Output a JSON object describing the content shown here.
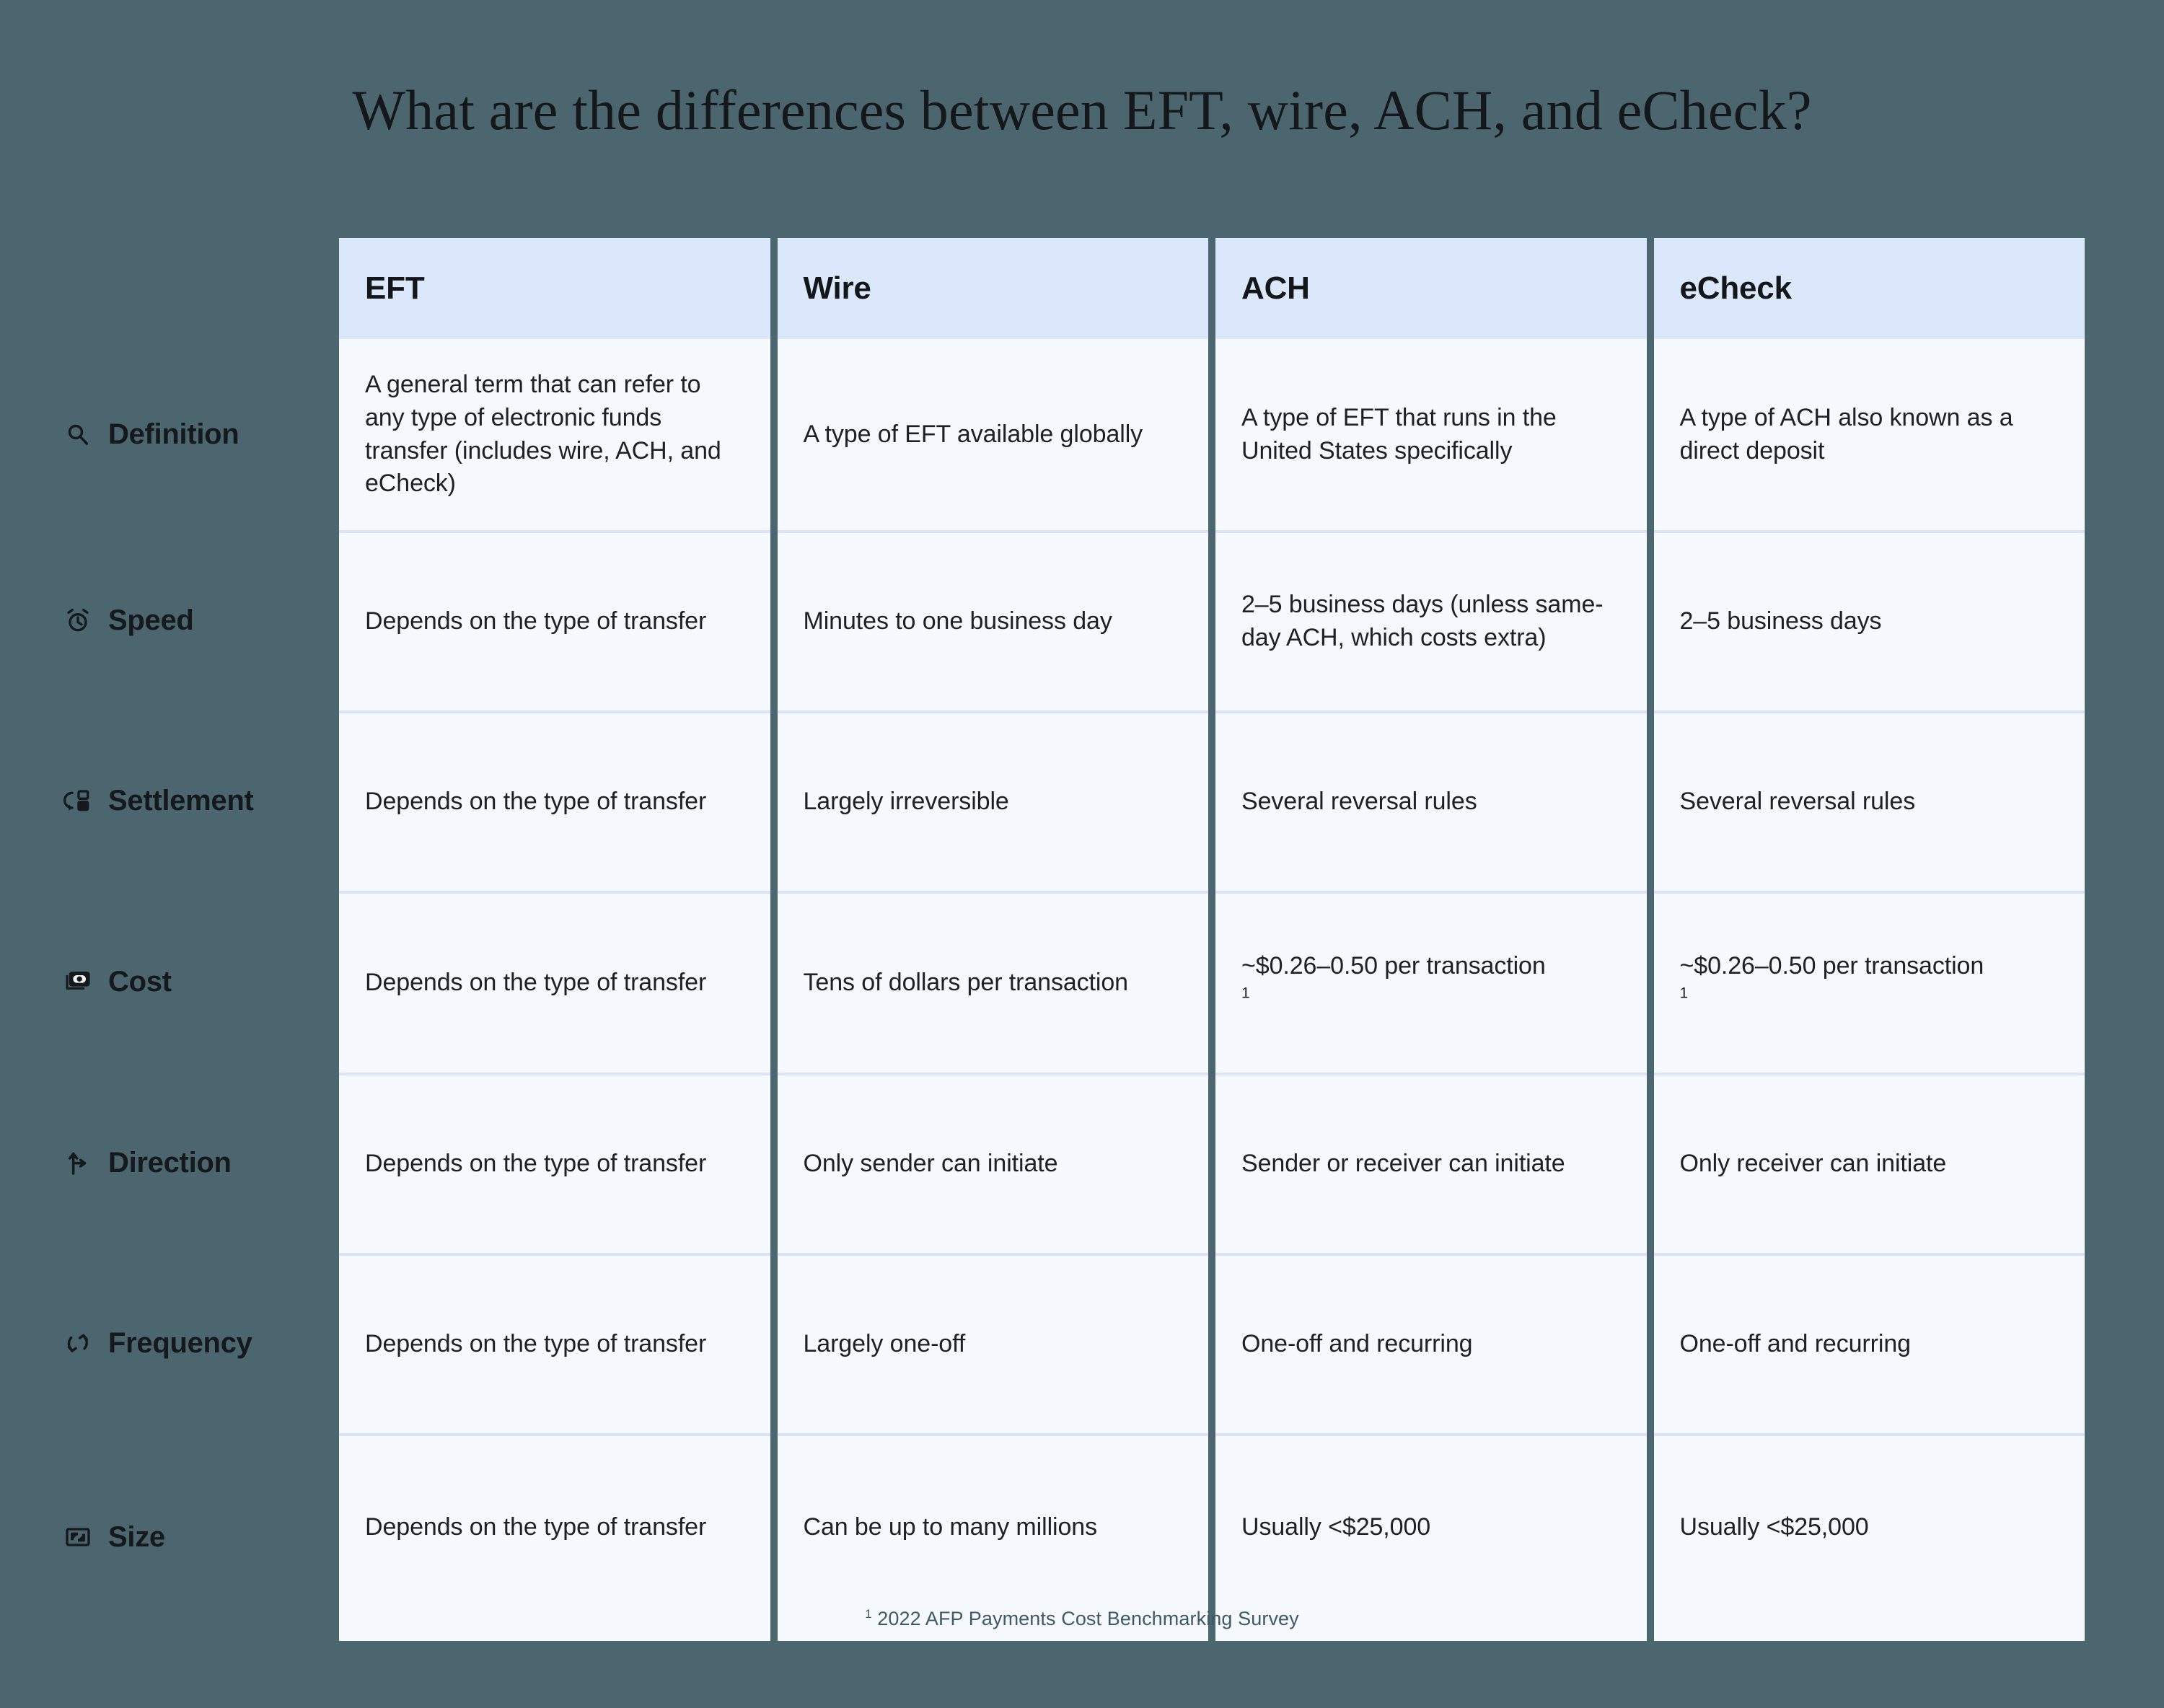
{
  "title": "What are the differences between EFT, wire, ACH, and eCheck?",
  "colors": {
    "page_background": "#4b666f",
    "header_cell_background": "#dbe8fb",
    "body_cell_background": "#f5f8fd",
    "row_divider": "#d7e4fa",
    "text": "#1d2124",
    "footnote_text": "#3f5a64"
  },
  "table": {
    "columns": [
      {
        "key": "eft",
        "label": "EFT"
      },
      {
        "key": "wire",
        "label": "Wire"
      },
      {
        "key": "ach",
        "label": "ACH"
      },
      {
        "key": "echeck",
        "label": "eCheck"
      }
    ],
    "rows": [
      {
        "key": "definition",
        "label": "Definition",
        "icon": "search-icon",
        "cells": [
          "A general term that can refer to any type of electronic funds transfer (includes wire, ACH, and eCheck)",
          "A type of EFT available globally",
          "A type of EFT that runs in the United States specifically",
          "A type of ACH also known as a direct deposit"
        ]
      },
      {
        "key": "speed",
        "label": "Speed",
        "icon": "alarm-clock-icon",
        "cells": [
          "Depends on the type of transfer",
          "Minutes to one business day",
          "2–5 business days (unless same-day ACH, which costs extra)",
          "2–5 business days"
        ]
      },
      {
        "key": "settlement",
        "label": "Settlement",
        "icon": "card-return-icon",
        "cells": [
          "Depends on the type of transfer",
          "Largely irreversible",
          "Several reversal rules",
          "Several reversal rules"
        ]
      },
      {
        "key": "cost",
        "label": "Cost",
        "icon": "banknotes-icon",
        "cells": [
          "Depends on the type of transfer",
          "Tens of dollars per transaction",
          "~$0.26–0.50 per transaction",
          "~$0.26–0.50 per transaction"
        ],
        "cell_footnotes": [
          null,
          null,
          "1",
          "1"
        ]
      },
      {
        "key": "direction",
        "label": "Direction",
        "icon": "fork-arrow-icon",
        "cells": [
          "Depends on the type of transfer",
          "Only sender can initiate",
          "Sender or receiver can initiate",
          "Only receiver can initiate"
        ]
      },
      {
        "key": "frequency",
        "label": "Frequency",
        "icon": "refresh-cycle-icon",
        "cells": [
          "Depends on the type of transfer",
          "Largely one-off",
          "One-off and recurring",
          "One-off and recurring"
        ]
      },
      {
        "key": "size",
        "label": "Size",
        "icon": "resize-frame-icon",
        "cells": [
          "Depends on the type of transfer",
          "Can be up to many millions",
          "Usually <$25,000",
          "Usually <$25,000"
        ]
      }
    ]
  },
  "footnote": {
    "marker": "1",
    "text": "2022 AFP Payments Cost Benchmarking Survey"
  }
}
